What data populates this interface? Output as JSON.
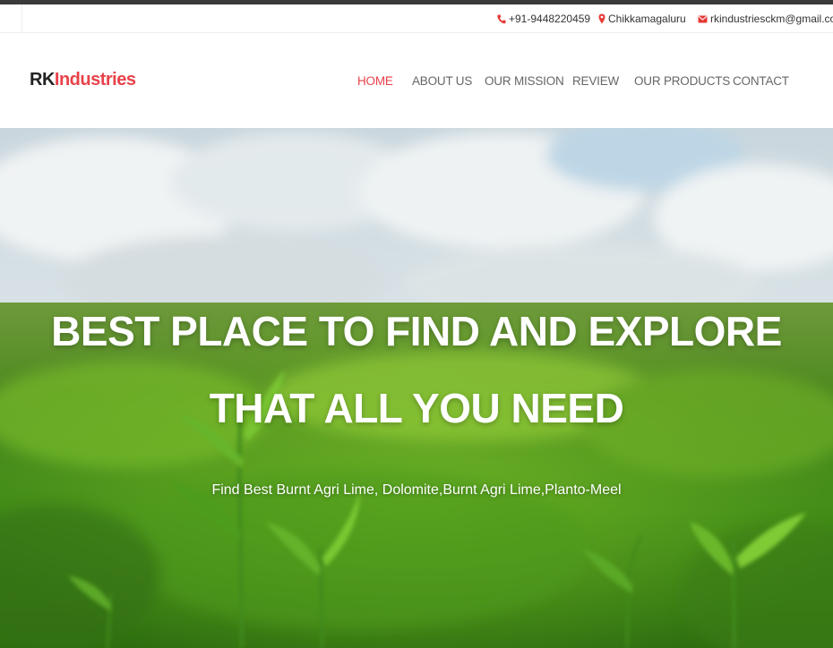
{
  "topbar": {
    "phone": "+91-9448220459",
    "location": "Chikkamagaluru",
    "email": "rkindustriesckm@gmail.com",
    "icons": [
      "phone-icon",
      "map-marker-icon",
      "envelope-icon"
    ]
  },
  "brand": {
    "part1": "RK",
    "part2": "Industries"
  },
  "nav": {
    "items": [
      {
        "label": "HOME",
        "active": true
      },
      {
        "label": "ABOUT US",
        "active": false
      },
      {
        "label": "OUR MISSION",
        "active": false
      },
      {
        "label": "REVIEW",
        "active": false
      },
      {
        "label": "OUR PRODUCTS",
        "active": false
      },
      {
        "label": "CONTACT",
        "active": false
      }
    ]
  },
  "hero": {
    "title_line1": "BEST PLACE TO FIND AND EXPLORE",
    "title_line2": "THAT ALL YOU NEED",
    "subtitle": "Find Best Burnt Agri Lime, Dolomite,Burnt Agri Lime,Planto-Meel"
  },
  "colors": {
    "accent": "#e8424a",
    "nav_text": "#666666",
    "top_strip": "#3a3a3a"
  }
}
